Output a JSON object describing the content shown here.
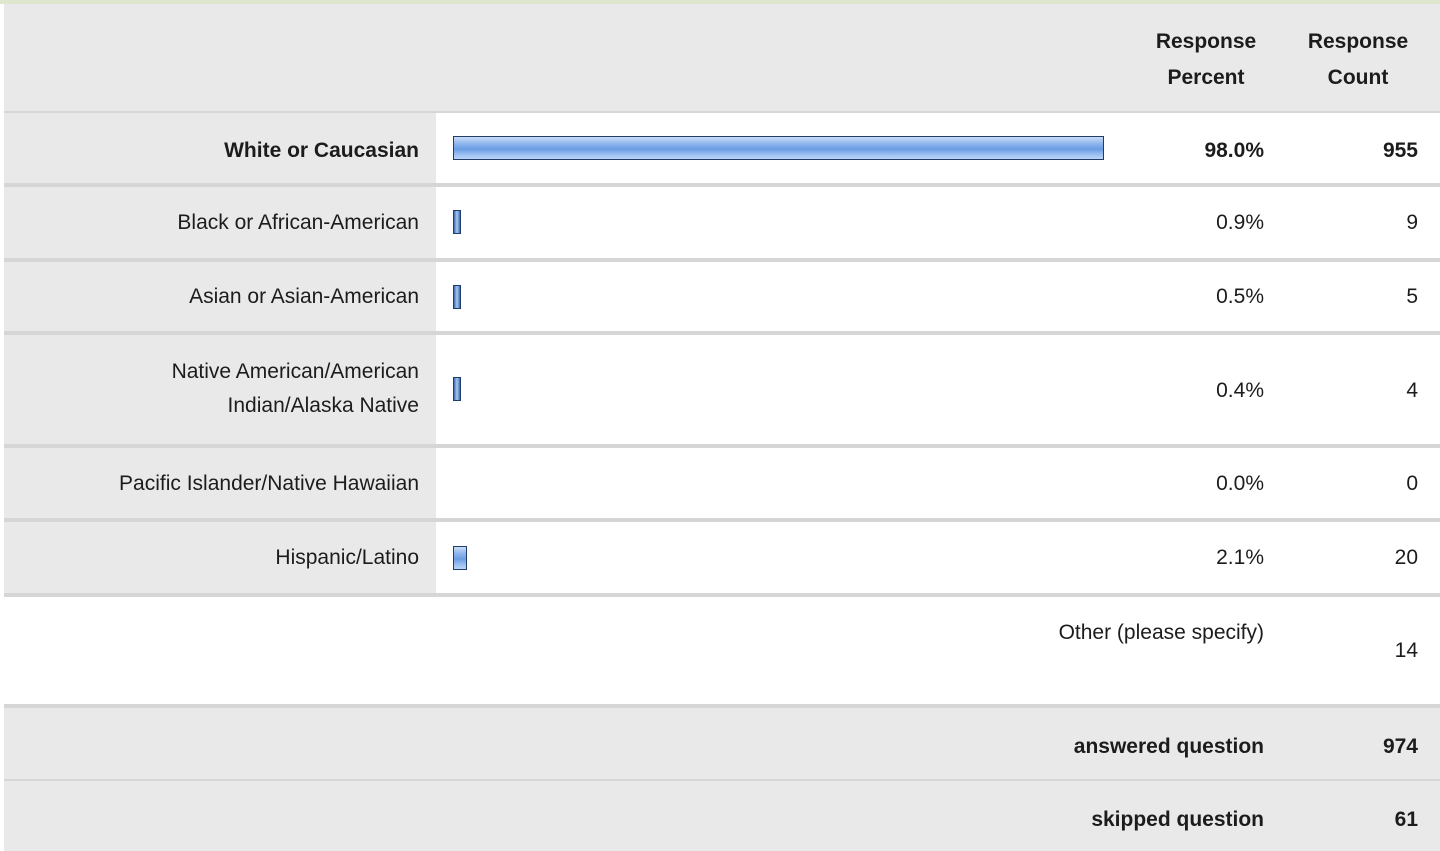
{
  "headers": {
    "percent": "Response Percent",
    "count": "Response Count"
  },
  "chart_data": {
    "type": "bar",
    "categories": [
      "White or Caucasian",
      "Black or African-American",
      "Asian or Asian-American",
      "Native American/American Indian/Alaska Native",
      "Pacific Islander/Native Hawaiian",
      "Hispanic/Latino"
    ],
    "values": [
      98.0,
      0.9,
      0.5,
      0.4,
      0.0,
      2.1
    ],
    "percent_labels": [
      "98.0%",
      "0.9%",
      "0.5%",
      "0.4%",
      "0.0%",
      "2.1%"
    ],
    "counts": [
      "955",
      "9",
      "5",
      "4",
      "0",
      "20"
    ],
    "ylim": [
      0,
      100
    ]
  },
  "other": {
    "label": "Other (please specify)",
    "count": "14"
  },
  "summary": {
    "answered_label": "answered question",
    "answered_count": "974",
    "skipped_label": "skipped question",
    "skipped_count": "61"
  },
  "colors": {
    "bar_fill": "#6a9de3",
    "bar_border": "#1f3d66",
    "row_bg": "#e9e9e9",
    "separator": "#d6d6d6"
  }
}
